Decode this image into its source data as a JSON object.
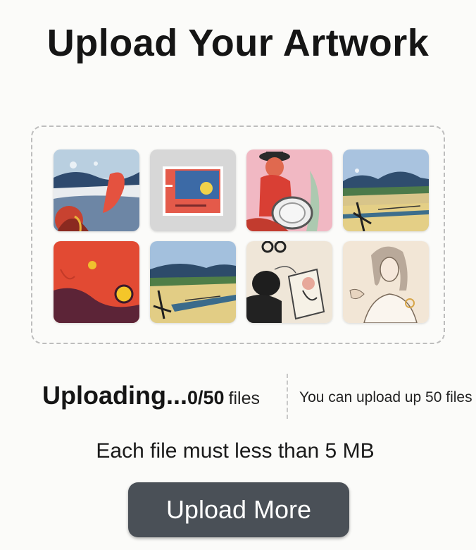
{
  "title": "Upload Your Artwork",
  "gallery": {
    "thumbnails": [
      {
        "name": "abstract-landscape-thumbnail"
      },
      {
        "name": "framed-painting-thumbnail"
      },
      {
        "name": "red-figure-thumbnail"
      },
      {
        "name": "field-landscape-thumbnail"
      },
      {
        "name": "red-abstract-thumbnail"
      },
      {
        "name": "field-landscape-2-thumbnail"
      },
      {
        "name": "sketch-figures-thumbnail"
      },
      {
        "name": "portrait-sketch-thumbnail"
      }
    ]
  },
  "status": {
    "uploading_label": "Uploading...",
    "count": "0/50",
    "files_label": "files",
    "limit_text": "You can upload up 50 files"
  },
  "size_note": "Each file must less than 5 MB",
  "upload_button_label": "Upload More"
}
